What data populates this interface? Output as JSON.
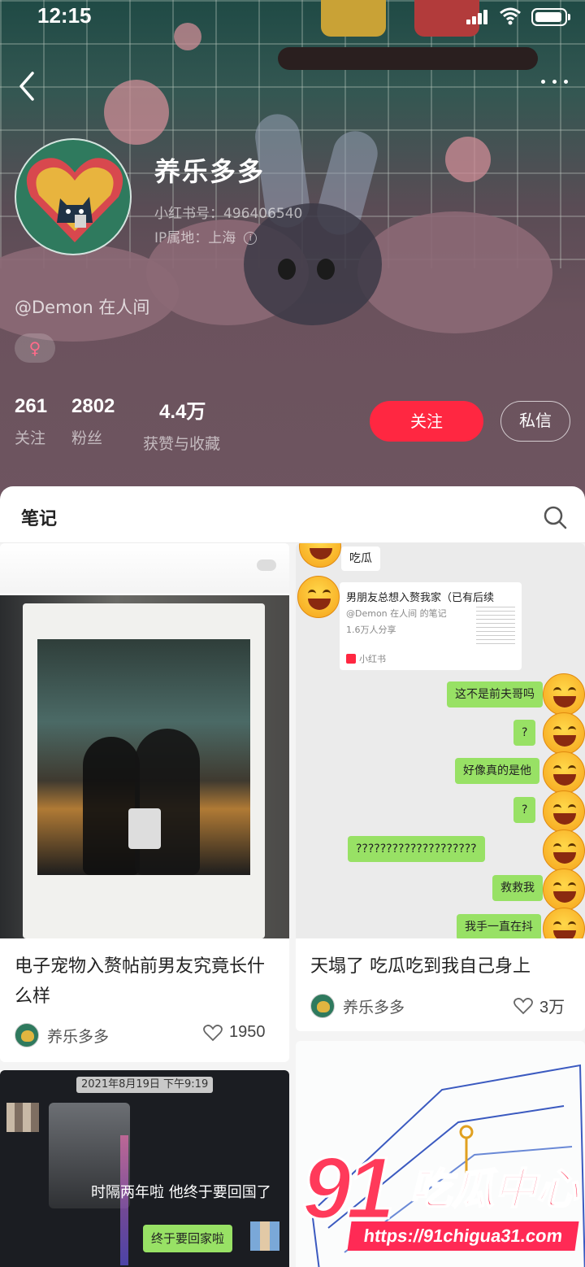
{
  "status_bar": {
    "time": "12:15"
  },
  "profile": {
    "name": "养乐多多",
    "red_id": "小红书号：496406540",
    "ip": "IP属地：上海",
    "bio": "@Demon 在人间",
    "gender_symbol": "♀",
    "stats": [
      {
        "value": "261",
        "label": "关注"
      },
      {
        "value": "2802",
        "label": "粉丝"
      },
      {
        "value": "4.4万",
        "label": "获赞与收藏"
      }
    ],
    "follow_label": "关注",
    "message_label": "私信"
  },
  "tabs": {
    "notes": "笔记"
  },
  "cards": [
    {
      "title": "电子宠物入赘帖前男友究竟长什么样",
      "author": "养乐多多",
      "likes": "1950"
    },
    {
      "title": "天塌了 吃瓜吃到我自己身上",
      "author": "养乐多多",
      "likes": "3万"
    }
  ],
  "chat": {
    "header": "吃瓜",
    "share_title": "男朋友总想入赘我家（已有后续",
    "share_sub": "@Demon 在人间 的笔记",
    "share_count": "1.6万人分享",
    "share_brand": "小红书",
    "messages": [
      "这不是前夫哥吗",
      "?",
      "好像真的是他",
      "?",
      "????????????????????",
      "救救我",
      "我手一直在抖"
    ]
  },
  "third_card": {
    "timestamp": "2021年8月19日 下午9:19",
    "caption": "时隔两年啦 他终于要回国了",
    "reply": "终于要回家啦"
  },
  "watermark": {
    "number": "91",
    "text": "吃瓜中心",
    "url": "https://91chigua31.com"
  },
  "colors": {
    "accent": "#ff2741",
    "chat_green": "#98e165"
  }
}
